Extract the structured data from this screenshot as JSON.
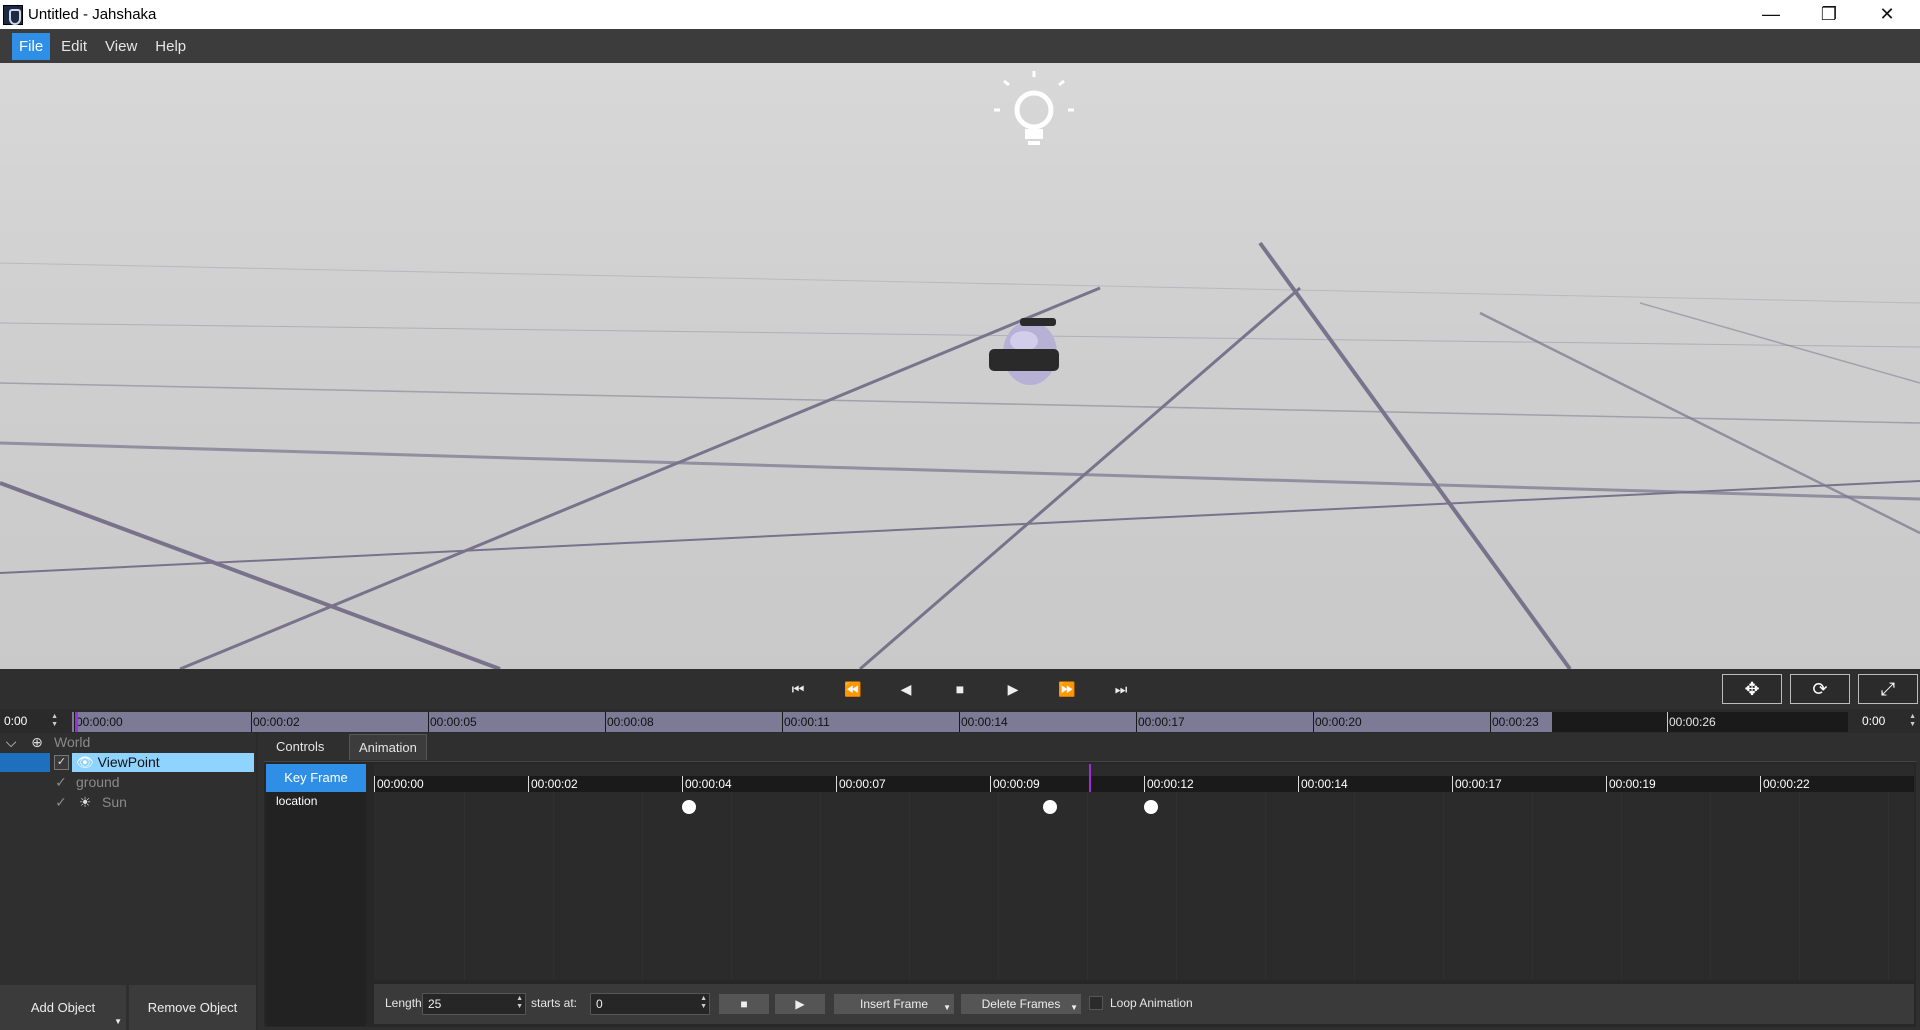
{
  "window": {
    "title": "Untitled - Jahshaka",
    "minimize": "—",
    "maximize": "❐",
    "close": "✕"
  },
  "menu": [
    "File",
    "Edit",
    "View",
    "Help"
  ],
  "transport": {
    "skip_start": "⏮",
    "rewind": "⏪",
    "step_back": "◀",
    "stop": "■",
    "play": "▶",
    "fast_forward": "⏩",
    "skip_end": "⏭",
    "view_buttons": [
      "✥",
      "⟳",
      "⤢"
    ]
  },
  "timeline": {
    "start_time": "0:00",
    "end_time": "0:00",
    "ticks": [
      "00:00:00",
      "00:00:02",
      "00:00:05",
      "00:00:08",
      "00:00:11",
      "00:00:14",
      "00:00:17",
      "00:00:20",
      "00:00:23",
      "00:00:26"
    ],
    "playhead_fraction": 0.0
  },
  "outliner": {
    "items": [
      {
        "label": "World",
        "icon": "globe-icon",
        "level": 0,
        "checked": null
      },
      {
        "label": "ViewPoint",
        "icon": "eye-icon",
        "level": 1,
        "checked": true,
        "selected": true
      },
      {
        "label": "ground",
        "icon": "",
        "level": 1,
        "checked": true
      },
      {
        "label": "Sun",
        "icon": "sun-icon",
        "level": 1,
        "checked": true
      }
    ],
    "add_button": "Add Object",
    "remove_button": "Remove Object"
  },
  "panel": {
    "tabs": [
      "Controls",
      "Animation"
    ],
    "active_tab": "Animation",
    "keyframe_header": "Key Frame",
    "tracks": [
      "location"
    ],
    "kf_ticks": [
      "00:00:00",
      "00:00:02",
      "00:00:04",
      "00:00:07",
      "00:00:09",
      "00:00:12",
      "00:00:14",
      "00:00:17",
      "00:00:19",
      "00:00:22"
    ],
    "keyframes_seconds": [
      4.7,
      10.1,
      11.6
    ],
    "controls": {
      "length_label": "Length",
      "length_value": "25",
      "starts_label": "starts at:",
      "starts_value": "0",
      "stop_icon": "■",
      "play_icon": "▶",
      "insert_frame": "Insert Frame",
      "delete_frames": "Delete Frames",
      "loop_label": "Loop Animation"
    }
  }
}
